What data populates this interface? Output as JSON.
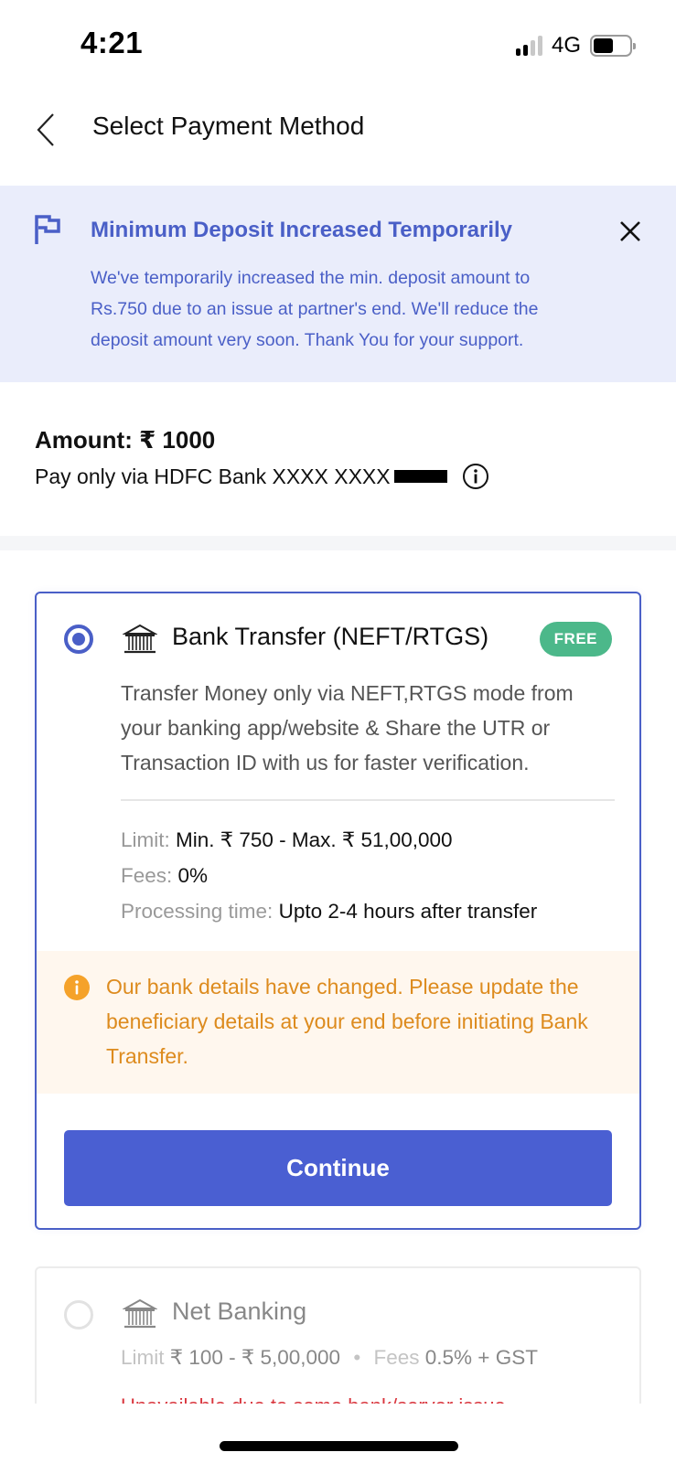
{
  "status_bar": {
    "time": "4:21",
    "network": "4G",
    "signal_bars": 2,
    "signal_total": 4,
    "battery_level": 0.5
  },
  "header": {
    "back_icon": "chevron-left-icon",
    "title": "Select Payment Method"
  },
  "notice": {
    "icon": "flag-icon",
    "title": "Minimum Deposit Increased Temporarily",
    "body": "We've temporarily increased the min. deposit amount to Rs.750 due to an issue at partner's end. We'll reduce the deposit amount very soon. Thank You for your support.",
    "close_icon": "close-icon"
  },
  "amount": {
    "label": "Amount: ₹ 1000",
    "pay_via": "Pay only via HDFC Bank XXXX XXXX",
    "info_icon": "info-icon"
  },
  "methods": [
    {
      "title": "Bank Transfer (NEFT/RTGS)",
      "selected": true,
      "badge": "FREE",
      "description": "Transfer Money only via NEFT,RTGS mode from your banking app/website & Share the UTR or Transaction ID with us for faster verification.",
      "details": [
        {
          "key": "Limit:",
          "value": "Min. ₹ 750 - Max. ₹ 51,00,000"
        },
        {
          "key": "Fees:",
          "value": "0%"
        },
        {
          "key": "Processing time:",
          "value": "Upto 2-4 hours after transfer"
        }
      ],
      "warning": "Our bank details have changed. Please update the beneficiary details at your end before initiating Bank Transfer.",
      "cta": "Continue"
    },
    {
      "title": "Net Banking",
      "selected": false,
      "limit_key": "Limit",
      "limit_value": "₹ 100 - ₹ 5,00,000",
      "separator": "•",
      "fees_key": "Fees",
      "fees_value": "0.5% + GST",
      "warning_partial": "Unavailable due to some bank/server issue"
    }
  ],
  "colors": {
    "accent": "#4a5fc7",
    "button": "#4a5fd2",
    "notice_bg": "#eaedfb",
    "badge_green": "#4cb88a",
    "warning_text": "#dd8b1e",
    "warning_bg": "#fff7ee",
    "error_red": "#d9363e"
  }
}
